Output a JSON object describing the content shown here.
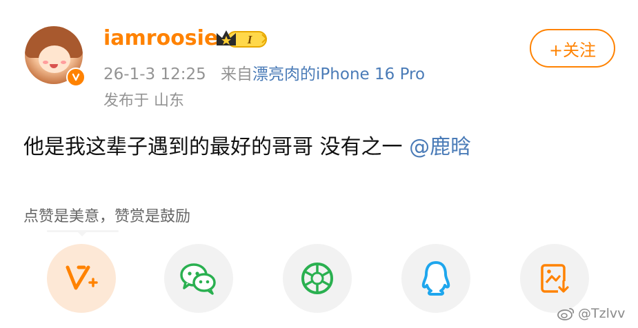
{
  "post": {
    "username": "iamroosie",
    "vip_level": "I",
    "date": "26-1-3 12:25",
    "source_prefix": "来自",
    "source_device": "漂亮肉的iPhone 16 Pro",
    "location": "发布于 山东",
    "follow_label": "+关注",
    "text": "他是我这辈子遇到的最好的哥哥 没有之一",
    "mention": "@鹿晗"
  },
  "reward": {
    "hint": "点赞是美意，赞赏是鼓励"
  },
  "share": {
    "icons": [
      "v-plus-icon",
      "wechat-icon",
      "moments-icon",
      "qq-icon",
      "save-image-icon"
    ]
  },
  "watermark": {
    "text": "@Tzlvv"
  },
  "colors": {
    "brand_orange": "#ff8200",
    "link_blue": "#4a7bb7",
    "wechat_green": "#2ab050",
    "qq_blue": "#1ea6ed"
  }
}
